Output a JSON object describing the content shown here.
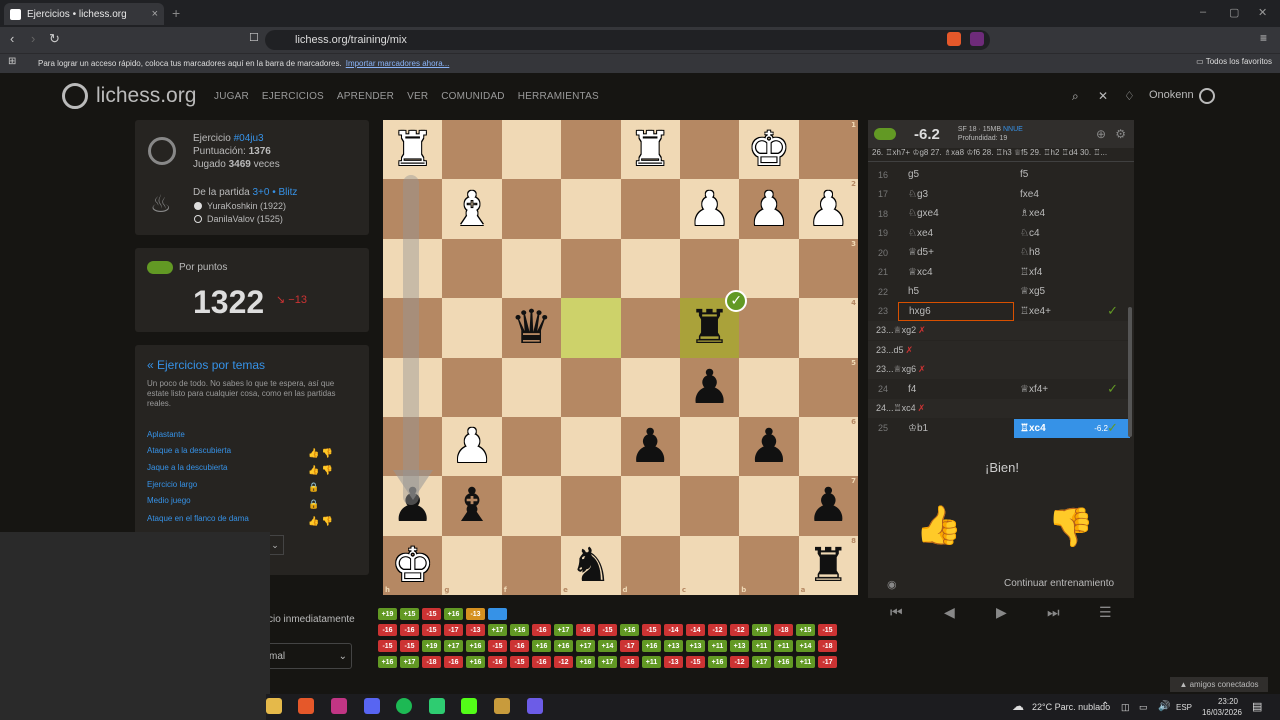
{
  "browser": {
    "tab_title": "Ejercicios • lichess.org",
    "tab_close": "×",
    "new_tab": "+",
    "url": "lichess.org/training/mix",
    "bookmarks_prompt": "Para lograr un acceso rápido, coloca tus marcadores aquí en la barra de marcadores.",
    "bookmarks_import": "Importar marcadores ahora...",
    "all_favorites": "Todos los favoritos",
    "win_min": "–",
    "win_max": "▢",
    "win_close": "✕"
  },
  "site": {
    "logo": "lichess.org",
    "nav": [
      "JUGAR",
      "EJERCICIOS",
      "APRENDER",
      "VER",
      "COMUNIDAD",
      "HERRAMIENTAS"
    ],
    "username": "Onokenn"
  },
  "puzzle": {
    "label": "Ejercicio",
    "id": "#04ju3",
    "rating_label": "Puntuación:",
    "rating": "1376",
    "played_label": "Jugado",
    "played": "3469",
    "played_suffix": "veces",
    "from_game": "De la partida",
    "game_type": "3+0 • Blitz",
    "white_player": "YuraKoshkin (1922)",
    "black_player": "DanilaValov (1525)"
  },
  "score": {
    "toggle_label": "Por puntos",
    "value": "1322",
    "diff": "−13"
  },
  "themes": {
    "title": "« Ejercicios por temas",
    "description": "Un poco de todo. No sabes lo que te espera, así que estate listo para cualquier cosa, como en las partidas reales.",
    "items": [
      "Aplastante",
      "Ataque a la descubierta",
      "Jaque a la descubierta",
      "Ejercicio largo",
      "Medio juego",
      "Ataque en el flanco de dama"
    ],
    "partial_1": "cio inmediatamente",
    "partial_2": "mal"
  },
  "engine": {
    "eval": "-6.2",
    "name": "SF 18 · 15MB",
    "nnue": "NNUE",
    "depth": "Profundidad: 19",
    "pv": "26. ♖xh7+ ♔g8 27. ♗xa8 ♔f6 28. ♖h3 ♕f5 29. ♖h2 ♖d4 30. ♖..."
  },
  "moves": [
    {
      "n": "16",
      "w": "g5",
      "b": "f5"
    },
    {
      "n": "17",
      "w": "♘g3",
      "b": "fxe4"
    },
    {
      "n": "18",
      "w": "♘gxe4",
      "b": "♗xe4"
    },
    {
      "n": "19",
      "w": "♘xe4",
      "b": "♘c4"
    },
    {
      "n": "20",
      "w": "♕d5+",
      "b": "♘h8"
    },
    {
      "n": "21",
      "w": "♕xc4",
      "b": "♖xf4"
    },
    {
      "n": "22",
      "w": "h5",
      "b": "♕xg5"
    },
    {
      "n": "23",
      "w": "hxg6",
      "b": "♖xe4+"
    }
  ],
  "variations": [
    "23...♕xg2",
    "23...d5",
    "23...♕xg6"
  ],
  "move24": {
    "n": "24",
    "w": "f4",
    "b": "♕xf4+"
  },
  "variation24": "24...♖xc4",
  "move25": {
    "n": "25",
    "w": "♔b1",
    "b": "♖xc4",
    "eval": "-6.2"
  },
  "feedback": {
    "text": "¡Bien!",
    "continue": "Continuar entrenamiento"
  },
  "board": {
    "files": [
      "h",
      "g",
      "f",
      "e",
      "d",
      "c",
      "b",
      "a"
    ],
    "ranks": [
      "1",
      "2",
      "3",
      "4",
      "5",
      "6",
      "7",
      "8"
    ],
    "pieces": [
      [
        "♜w",
        "",
        "",
        "",
        "♜w",
        "",
        "♚w",
        ""
      ],
      [
        "",
        "♝w",
        "",
        "",
        "",
        "♟w",
        "♟w",
        "♟w"
      ],
      [
        "",
        "",
        "",
        "",
        "",
        "",
        "",
        ""
      ],
      [
        "",
        "",
        "♛b",
        "",
        "",
        "♜b",
        "",
        ""
      ],
      [
        "",
        "",
        "",
        "",
        "",
        "♟b",
        "",
        ""
      ],
      [
        "",
        "♟w",
        "",
        "",
        "♟b",
        "",
        "♟b",
        ""
      ],
      [
        "♟b",
        "♝b",
        "",
        "",
        "",
        "",
        "",
        "♟b"
      ],
      [
        "♚w",
        "",
        "",
        "♞b",
        "",
        "",
        "",
        "♜b"
      ]
    ]
  },
  "tiles": [
    [
      [
        "+19",
        "g"
      ],
      [
        "+15",
        "g"
      ],
      [
        "-15",
        "r"
      ],
      [
        "+16",
        "g"
      ],
      [
        "-13",
        "o"
      ],
      [
        "",
        "b"
      ]
    ],
    [
      [
        "-16",
        "r"
      ],
      [
        "-16",
        "r"
      ],
      [
        "-15",
        "r"
      ],
      [
        "-17",
        "r"
      ],
      [
        "-13",
        "r"
      ],
      [
        "+17",
        "g"
      ],
      [
        "+16",
        "g"
      ],
      [
        "-16",
        "r"
      ],
      [
        "+17",
        "g"
      ],
      [
        "-16",
        "r"
      ],
      [
        "-15",
        "r"
      ],
      [
        "+16",
        "g"
      ],
      [
        "-15",
        "r"
      ],
      [
        "-14",
        "r"
      ],
      [
        "-14",
        "r"
      ],
      [
        "-12",
        "r"
      ],
      [
        "-12",
        "r"
      ],
      [
        "+18",
        "g"
      ],
      [
        "-18",
        "r"
      ],
      [
        "+15",
        "g"
      ],
      [
        "-15",
        "r"
      ]
    ],
    [
      [
        "-15",
        "r"
      ],
      [
        "-15",
        "r"
      ],
      [
        "+19",
        "g"
      ],
      [
        "+17",
        "g"
      ],
      [
        "+16",
        "g"
      ],
      [
        "-15",
        "r"
      ],
      [
        "-16",
        "r"
      ],
      [
        "+16",
        "g"
      ],
      [
        "+16",
        "g"
      ],
      [
        "+17",
        "g"
      ],
      [
        "+14",
        "g"
      ],
      [
        "-17",
        "r"
      ],
      [
        "+16",
        "g"
      ],
      [
        "+13",
        "g"
      ],
      [
        "+13",
        "g"
      ],
      [
        "+11",
        "g"
      ],
      [
        "+13",
        "g"
      ],
      [
        "+11",
        "g"
      ],
      [
        "+11",
        "g"
      ],
      [
        "+14",
        "g"
      ],
      [
        "-18",
        "r"
      ]
    ],
    [
      [
        "+16",
        "g"
      ],
      [
        "+17",
        "g"
      ],
      [
        "-18",
        "r"
      ],
      [
        "-16",
        "r"
      ],
      [
        "+16",
        "g"
      ],
      [
        "-16",
        "r"
      ],
      [
        "-15",
        "r"
      ],
      [
        "-16",
        "r"
      ],
      [
        "-12",
        "r"
      ],
      [
        "+16",
        "g"
      ],
      [
        "+17",
        "g"
      ],
      [
        "-16",
        "r"
      ],
      [
        "+11",
        "g"
      ],
      [
        "-13",
        "r"
      ],
      [
        "-15",
        "r"
      ],
      [
        "+16",
        "g"
      ],
      [
        "-12",
        "r"
      ],
      [
        "+17",
        "g"
      ],
      [
        "+16",
        "g"
      ],
      [
        "+11",
        "g"
      ],
      [
        "-17",
        "r"
      ]
    ]
  ],
  "system": {
    "friends": "▲ amigos conectados",
    "weather": "22°C  Parc. nublado",
    "lang": "ESP",
    "time": "23:20",
    "date": "16/03/2026"
  }
}
